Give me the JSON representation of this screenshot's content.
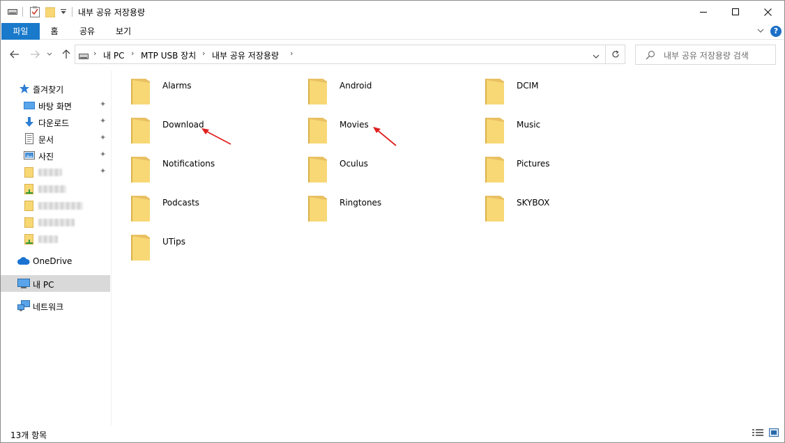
{
  "window": {
    "title": "내부 공유 저장용량"
  },
  "ribbon": {
    "tabs": [
      "파일",
      "홈",
      "공유",
      "보기"
    ],
    "help": "?"
  },
  "address": {
    "parts": [
      "내 PC",
      "MTP USB 장치",
      "내부 공유 저장용량"
    ]
  },
  "search": {
    "placeholder": "내부 공유 저장용량 검색"
  },
  "sidebar": {
    "quick_access": "즐겨찾기",
    "pinned": [
      "바탕 화면",
      "다운로드",
      "문서",
      "사진"
    ],
    "onedrive": "OneDrive",
    "this_pc": "내 PC",
    "network": "네트워크"
  },
  "folders": [
    "Alarms",
    "Android",
    "DCIM",
    "Download",
    "Movies",
    "Music",
    "Notifications",
    "Oculus",
    "Pictures",
    "Podcasts",
    "Ringtones",
    "SKYBOX",
    "UTips"
  ],
  "status": {
    "count": "13개 항목"
  },
  "colors": {
    "accent": "#1979ca",
    "folder": "#f8d775",
    "annotation_arrow": "#e02020"
  }
}
